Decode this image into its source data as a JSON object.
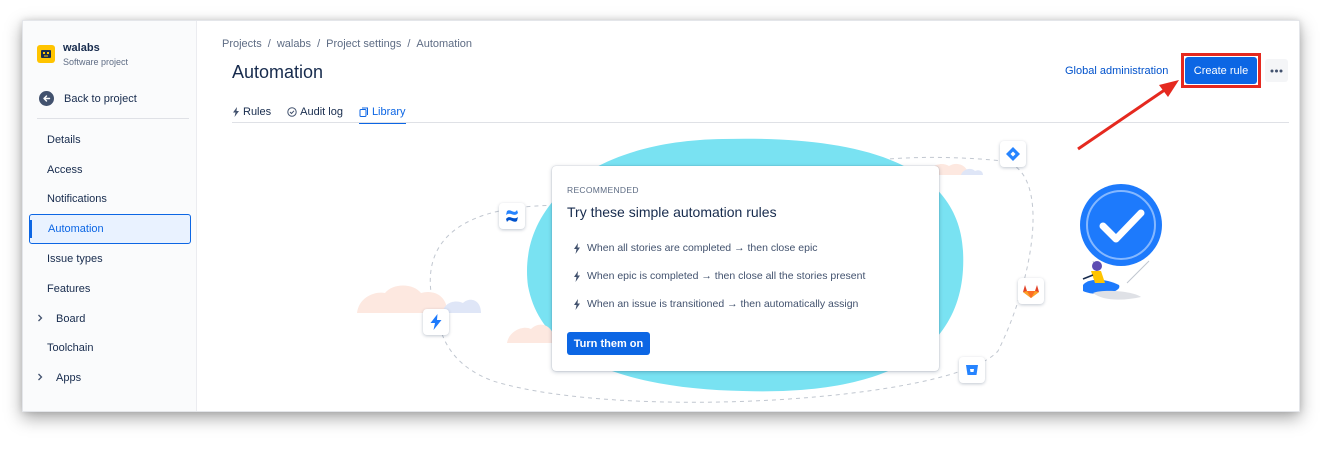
{
  "project": {
    "name": "walabs",
    "type": "Software project"
  },
  "sidebar": {
    "back_label": "Back to project",
    "items": [
      {
        "label": "Details"
      },
      {
        "label": "Access"
      },
      {
        "label": "Notifications"
      },
      {
        "label": "Automation",
        "active": true
      },
      {
        "label": "Issue types"
      },
      {
        "label": "Features"
      },
      {
        "label": "Board",
        "expandable": true
      },
      {
        "label": "Toolchain"
      },
      {
        "label": "Apps",
        "expandable": true
      }
    ]
  },
  "breadcrumb": [
    "Projects",
    "/",
    "walabs",
    "/",
    "Project settings",
    "/",
    "Automation"
  ],
  "header": {
    "title": "Automation",
    "global_admin_label": "Global administration",
    "create_rule_label": "Create rule"
  },
  "tabs": [
    {
      "label": "Rules"
    },
    {
      "label": "Audit log"
    },
    {
      "label": "Library",
      "active": true
    }
  ],
  "card": {
    "eyebrow": "RECOMMENDED",
    "title": "Try these simple automation rules",
    "rules": [
      "When all stories are completed → then close epic",
      "When epic is completed → then close all the stories present",
      "When an issue is transitioned → then automatically assign"
    ],
    "button_label": "Turn them on"
  },
  "colors": {
    "brand": "#0c66e4",
    "highlight": "#e5291f",
    "blob": "#79e2f2"
  }
}
